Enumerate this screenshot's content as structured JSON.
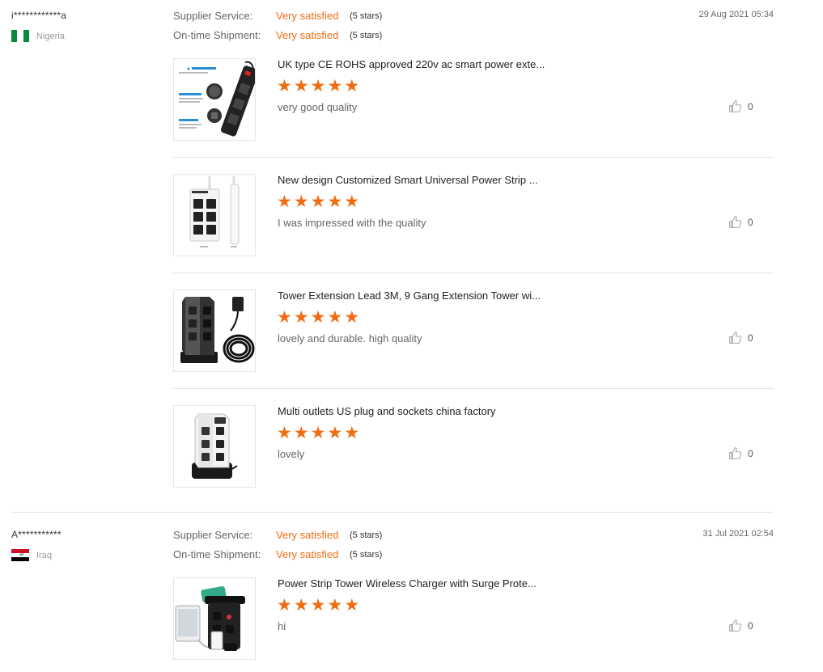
{
  "reviews": [
    {
      "reviewer": "i************a",
      "country": "Nigeria",
      "supplier_service_label": "Supplier Service:",
      "supplier_service_value": "Very satisfied",
      "supplier_service_stars": "(5 stars)",
      "shipment_label": "On-time Shipment:",
      "shipment_value": "Very satisfied",
      "shipment_stars": "(5 stars)",
      "date": "29 Aug 2021 05:34",
      "products": [
        {
          "title": "UK type CE ROHS approved 220v ac smart power exte...",
          "rating": 5,
          "comment": "very good quality",
          "likes": "0"
        },
        {
          "title": "New design Customized Smart Universal Power Strip ...",
          "rating": 5,
          "comment": "I was impressed with the quality",
          "likes": "0"
        },
        {
          "title": "Tower Extension Lead 3M, 9 Gang Extension Tower wi...",
          "rating": 5,
          "comment": "lovely and durable. high quality",
          "likes": "0"
        },
        {
          "title": "Multi outlets US plug and sockets china factory",
          "rating": 5,
          "comment": "lovely",
          "likes": "0"
        }
      ]
    },
    {
      "reviewer": "A***********",
      "country": "Iraq",
      "supplier_service_label": "Supplier Service:",
      "supplier_service_value": "Very satisfied",
      "supplier_service_stars": "(5 stars)",
      "shipment_label": "On-time Shipment:",
      "shipment_value": "Very satisfied",
      "shipment_stars": "(5 stars)",
      "date": "31 Jul 2021 02:54",
      "products": [
        {
          "title": "Power Strip Tower Wireless Charger with Surge Prote...",
          "rating": 5,
          "comment": "hi",
          "likes": "0"
        }
      ]
    }
  ],
  "colors": {
    "accent": "#f06c11",
    "divider": "#e3e3e3"
  },
  "icons": {
    "like": "thumbs-up-icon",
    "star": "star-icon"
  }
}
